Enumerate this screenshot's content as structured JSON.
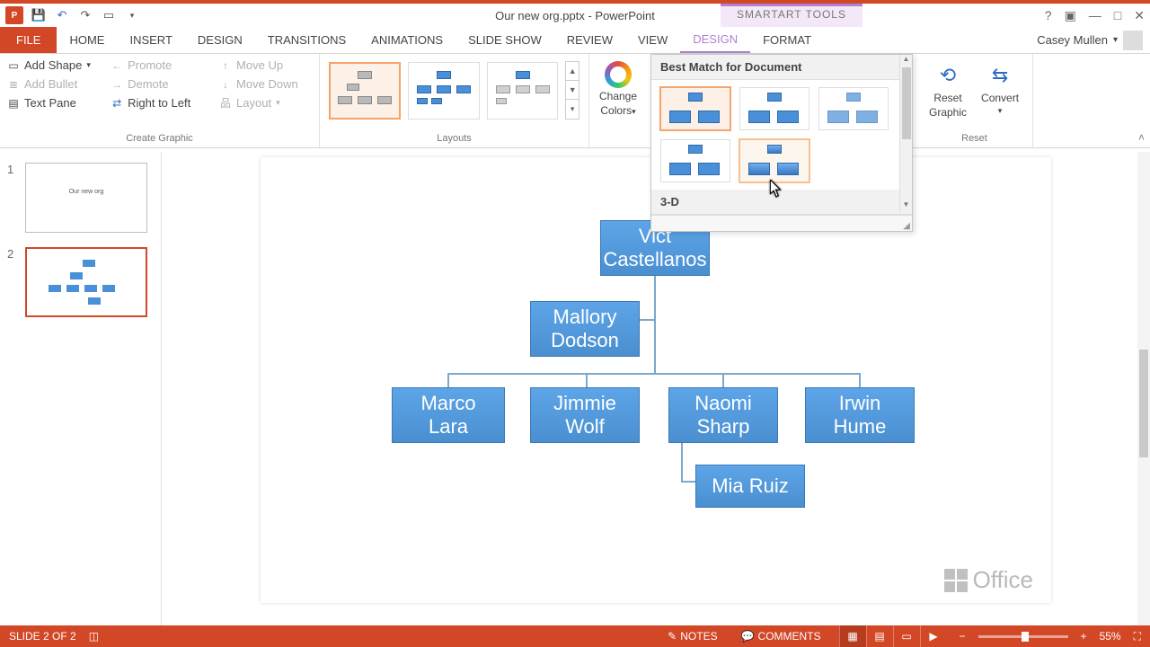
{
  "titlebar": {
    "title": "Our new org.pptx - PowerPoint",
    "context_tab": "SMARTART TOOLS"
  },
  "tabs": {
    "file": "FILE",
    "home": "HOME",
    "insert": "INSERT",
    "design": "DESIGN",
    "transitions": "TRANSITIONS",
    "animations": "ANIMATIONS",
    "slideshow": "SLIDE SHOW",
    "review": "REVIEW",
    "view": "VIEW",
    "sa_design": "DESIGN",
    "sa_format": "FORMAT"
  },
  "user": {
    "name": "Casey Mullen"
  },
  "ribbon": {
    "create_graphic": {
      "add_shape": "Add Shape",
      "add_bullet": "Add Bullet",
      "text_pane": "Text Pane",
      "promote": "Promote",
      "demote": "Demote",
      "right_to_left": "Right to Left",
      "move_up": "Move Up",
      "move_down": "Move Down",
      "layout": "Layout",
      "label": "Create Graphic"
    },
    "layouts_label": "Layouts",
    "change_colors_line1": "Change",
    "change_colors_line2": "Colors",
    "reset_line1": "Reset",
    "reset_line2": "Graphic",
    "convert": "Convert",
    "reset_label": "Reset"
  },
  "flyout": {
    "header_best": "Best Match for Document",
    "header_3d": "3-D"
  },
  "thumbs": {
    "slide1_title": "Our new org"
  },
  "org": {
    "n1": "Vict\nCastellanos",
    "n2": "Mallory\nDodson",
    "n3": "Marco Lara",
    "n4": "Jimmie\nWolf",
    "n5": "Naomi\nSharp",
    "n6": "Irwin\nHume",
    "n7": "Mia Ruiz"
  },
  "office_logo": "Office",
  "status": {
    "slide": "SLIDE 2 OF 2",
    "notes": "NOTES",
    "comments": "COMMENTS",
    "zoom": "55%"
  }
}
